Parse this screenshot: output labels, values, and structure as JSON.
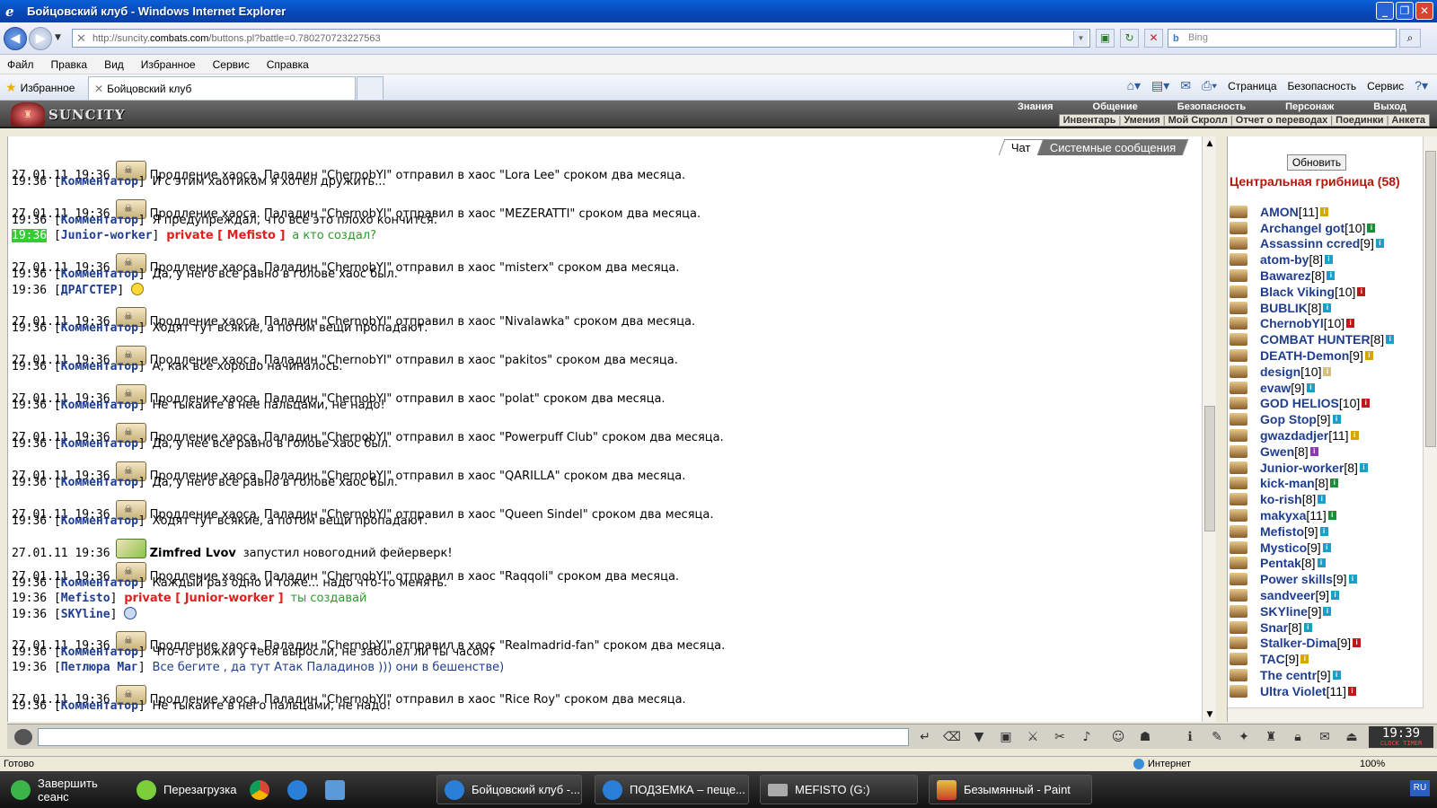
{
  "window": {
    "title": "Бойцовский клуб - Windows Internet Explorer",
    "url_prefix": "http://suncity.",
    "url_domain": "combats.com",
    "url_rest": "/buttons.pl?battle=0.780270723227563",
    "search_placeholder": "Bing"
  },
  "menu": [
    "Файл",
    "Правка",
    "Вид",
    "Избранное",
    "Сервис",
    "Справка"
  ],
  "favorites": {
    "label": "Избранное",
    "tab_title": "Бойцовский клуб",
    "commands": [
      "Страница",
      "Безопасность",
      "Сервис"
    ]
  },
  "game": {
    "logo": "SUNCITY",
    "menu_top": [
      "Знания",
      "Общение",
      "Безопасность",
      "Персонаж",
      "Выход"
    ],
    "menu_bottom": [
      "Инвентарь",
      "Умения",
      "Мой Скролл",
      "Отчет о переводах",
      "Поединки",
      "Анкета"
    ]
  },
  "chat": {
    "tabs": [
      "Чат",
      "Системные сообщения"
    ],
    "lines": [
      {
        "type": "sys",
        "ts": "27.01.11 19:36",
        "text": "Продление хаоса. Паладин \"ChernobYl\" отправил в хаос \"Lora Lee\" сроком два месяца."
      },
      {
        "type": "msg",
        "ts": "19:36",
        "nick": "Комментатор",
        "text": "И с этим хаотиком я хотел дружить..."
      },
      {
        "type": "sys",
        "ts": "27.01.11 19:36",
        "text": "Продление хаоса. Паладин \"ChernobYl\" отправил в хаос \"MEZERATTI\" сроком два месяца."
      },
      {
        "type": "msg",
        "ts": "19:36",
        "nick": "Комментатор",
        "text": "Я предупреждал, что все это плохо кончится."
      },
      {
        "type": "priv",
        "ts": "19:36",
        "nick": "Junior-worker",
        "to": "private [ Mefisto ]",
        "text": "а кто создал?"
      },
      {
        "type": "sys",
        "ts": "27.01.11 19:36",
        "text": "Продление хаоса. Паладин \"ChernobYl\" отправил в хаос \"misterx\" сроком два месяца."
      },
      {
        "type": "msg",
        "ts": "19:36",
        "nick": "Комментатор",
        "text": "Да, у него все равно в голове хаос был."
      },
      {
        "type": "smile",
        "ts": "19:36",
        "nick": "ДРАГСТЕР"
      },
      {
        "type": "sys",
        "ts": "27.01.11 19:36",
        "text": "Продление хаоса. Паладин \"ChernobYl\" отправил в хаос \"Nivalawka\" сроком два месяца."
      },
      {
        "type": "msg",
        "ts": "19:36",
        "nick": "Комментатор",
        "text": "Ходят тут всякие, а потом вещи пропадают."
      },
      {
        "type": "sys",
        "ts": "27.01.11 19:36",
        "text": "Продление хаоса. Паладин \"ChernobYl\" отправил в хаос \"pakitos\" сроком два месяца."
      },
      {
        "type": "msg",
        "ts": "19:36",
        "nick": "Комментатор",
        "text": "А, как все хорошо начиналось."
      },
      {
        "type": "sys",
        "ts": "27.01.11 19:36",
        "text": "Продление хаоса. Паладин \"ChernobYl\" отправил в хаос \"polat\" сроком два месяца."
      },
      {
        "type": "msg",
        "ts": "19:36",
        "nick": "Комментатор",
        "text": "Не тыкайте в нее пальцами, не надо!"
      },
      {
        "type": "sys",
        "ts": "27.01.11 19:36",
        "text": "Продление хаоса. Паладин \"ChernobYl\" отправил в хаос \"Powerpuff Club\" сроком два месяца."
      },
      {
        "type": "msg",
        "ts": "19:36",
        "nick": "Комментатор",
        "text": "Да, у нее все равно в голове хаос был."
      },
      {
        "type": "sys",
        "ts": "27.01.11 19:36",
        "text": "Продление хаоса. Паладин \"ChernobYl\" отправил в хаос \"QARILLA\" сроком два месяца."
      },
      {
        "type": "msg",
        "ts": "19:36",
        "nick": "Комментатор",
        "text": "Да, у него все равно в голове хаос был."
      },
      {
        "type": "sys",
        "ts": "27.01.11 19:36",
        "text": "Продление хаоса. Паладин \"ChernobYl\" отправил в хаос \"Queen Sindel\" сроком два месяца."
      },
      {
        "type": "msg",
        "ts": "19:36",
        "nick": "Комментатор",
        "text": "Ходят тут всякие, а потом вещи пропадают."
      },
      {
        "type": "fw",
        "ts": "27.01.11 19:36",
        "who": "Zimfred Lvov",
        "text": "запустил новогодний фейерверк!"
      },
      {
        "type": "sys",
        "ts": "27.01.11 19:36",
        "text": "Продление хаоса. Паладин \"ChernobYl\" отправил в хаос \"Raqqoli\" сроком два месяца."
      },
      {
        "type": "msg",
        "ts": "19:36",
        "nick": "Комментатор",
        "text": "Каждый раз одно и тоже... надо что-то менять."
      },
      {
        "type": "priv",
        "ts": "19:36",
        "nick": "Mefisto",
        "to": "private [ Junior-worker ]",
        "text": "ты создавай"
      },
      {
        "type": "smile",
        "ts": "19:36",
        "nick": "SKYline"
      },
      {
        "type": "sys",
        "ts": "27.01.11 19:36",
        "text": "Продление хаоса. Паладин \"ChernobYl\" отправил в хаос \"Realmadrid-fan\" сроком два месяца."
      },
      {
        "type": "msg",
        "ts": "19:36",
        "nick": "Комментатор",
        "text": "Что-то рожки у тебя выросли, не заболел ли ты часом?"
      },
      {
        "type": "bluemsg",
        "ts": "19:36",
        "nick": "Петлюра Маг",
        "text": "Все бегите , да тут Атак Паладинов ))) они в бешенстве)"
      },
      {
        "type": "sys",
        "ts": "27.01.11 19:36",
        "text": "Продление хаоса. Паладин \"ChernobYl\" отправил в хаос \"Rice Roy\" сроком два месяца."
      },
      {
        "type": "msg",
        "ts": "19:36",
        "nick": "Комментатор",
        "text": "Не тыкайте в него пальцами, не надо!"
      }
    ]
  },
  "room": {
    "refresh_label": "Обновить",
    "name": "Центральная грибница (58)",
    "users": [
      {
        "name": "AMON",
        "level": "[11]",
        "info": "#D4A800"
      },
      {
        "name": "Archangel got",
        "level": "[10]",
        "info": "#1A8F3A"
      },
      {
        "name": "Assassinn ccred",
        "level": "[9]",
        "info": "#1AA0C8"
      },
      {
        "name": "atom-by",
        "level": "[8]",
        "info": "#1AA0C8"
      },
      {
        "name": "Bawarez",
        "level": "[8]",
        "info": "#1AA0C8"
      },
      {
        "name": "Black Viking",
        "level": "[10]",
        "info": "#C01818"
      },
      {
        "name": "BUBLIK",
        "level": "[8]",
        "info": "#1AA0C8"
      },
      {
        "name": "ChernobYl",
        "level": "[10]",
        "info": "#C01818"
      },
      {
        "name": "COMBAT HUNTER",
        "level": "[8]",
        "info": "#1AA0C8"
      },
      {
        "name": "DEATH-Demon",
        "level": "[9]",
        "info": "#D4A800"
      },
      {
        "name": "design",
        "level": "[10]",
        "info": "#D4C080"
      },
      {
        "name": "evaw",
        "level": "[9]",
        "info": "#1AA0C8"
      },
      {
        "name": "GOD HELIOS",
        "level": "[10]",
        "info": "#C01818"
      },
      {
        "name": "Gop Stop",
        "level": "[9]",
        "info": "#1AA0C8"
      },
      {
        "name": "gwazdadjer",
        "level": "[11]",
        "info": "#D4A800"
      },
      {
        "name": "Gwen",
        "level": "[8]",
        "info": "#8A3AB0"
      },
      {
        "name": "Junior-worker",
        "level": "[8]",
        "info": "#1AA0C8"
      },
      {
        "name": "kick-man",
        "level": "[8]",
        "info": "#1A8F3A"
      },
      {
        "name": "ko-rish",
        "level": "[8]",
        "info": "#1AA0C8"
      },
      {
        "name": "makyxa",
        "level": "[11]",
        "info": "#1A8F3A"
      },
      {
        "name": "Mefisto",
        "level": "[9]",
        "info": "#1AA0C8"
      },
      {
        "name": "Mystico",
        "level": "[9]",
        "info": "#1AA0C8"
      },
      {
        "name": "Pentak",
        "level": "[8]",
        "info": "#1AA0C8"
      },
      {
        "name": "Power skills",
        "level": "[9]",
        "info": "#1AA0C8"
      },
      {
        "name": "sandveer",
        "level": "[9]",
        "info": "#1AA0C8"
      },
      {
        "name": "SKYline",
        "level": "[9]",
        "info": "#1AA0C8"
      },
      {
        "name": "Snar",
        "level": "[8]",
        "info": "#1AA0C8"
      },
      {
        "name": "Stalker-Dima",
        "level": "[9]",
        "info": "#C01818"
      },
      {
        "name": "TAC",
        "level": "[9]",
        "info": "#D4A800"
      },
      {
        "name": "The centr",
        "level": "[9]",
        "info": "#1AA0C8"
      },
      {
        "name": "Ultra Violet",
        "level": "[11]",
        "info": "#C01818"
      }
    ]
  },
  "clock": {
    "time": "19:39",
    "sub": "CLOCK TIMER"
  },
  "status": {
    "left": "Готово",
    "zone": "Интернет",
    "zoom": "100%"
  },
  "taskbar": {
    "start1": "Завершить сеанс",
    "start2": "Перезагрузка",
    "windows": [
      "Бойцовский клуб -...",
      "ПОДЗЕМКА – пеще...",
      "MEFISTO (G:)",
      "Безымянный - Paint"
    ],
    "lang": "RU"
  }
}
